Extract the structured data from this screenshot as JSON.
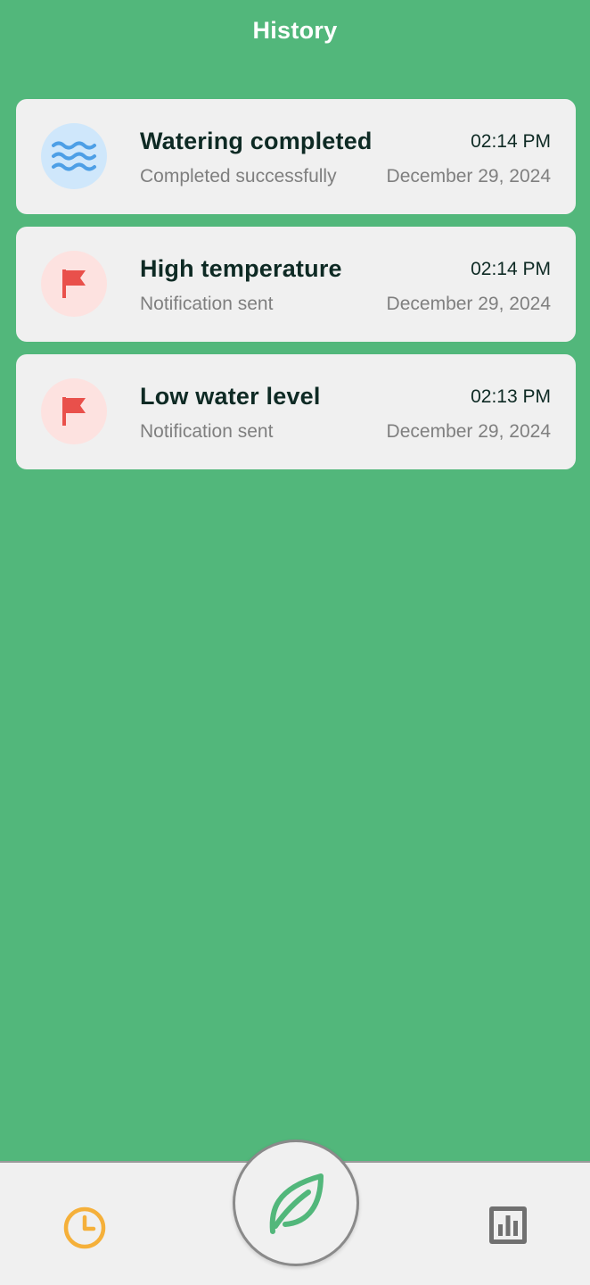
{
  "header": {
    "title": "History"
  },
  "events": [
    {
      "type": "watering",
      "icon": "water-waves-icon",
      "title": "Watering completed",
      "subtitle": "Completed successfully",
      "time": "02:14 PM",
      "date": "December 29, 2024"
    },
    {
      "type": "alert",
      "icon": "flag-icon",
      "title": "High temperature",
      "subtitle": "Notification sent",
      "time": "02:14 PM",
      "date": "December 29, 2024"
    },
    {
      "type": "alert",
      "icon": "flag-icon",
      "title": "Low water level",
      "subtitle": "Notification sent",
      "time": "02:13 PM",
      "date": "December 29, 2024"
    }
  ],
  "bottom_nav": {
    "history_icon": "clock-icon",
    "home_icon": "leaf-icon",
    "stats_icon": "bar-chart-icon",
    "active": "history"
  },
  "colors": {
    "background": "#52b77b",
    "card": "#f0f0f0",
    "water_icon": "#4d9fe6",
    "water_icon_bg": "#cfe7fb",
    "flag_icon": "#e9504b",
    "flag_icon_bg": "#fde2e0",
    "active_nav": "#f5b03a",
    "inactive_nav": "#707070",
    "leaf": "#52b77b"
  }
}
